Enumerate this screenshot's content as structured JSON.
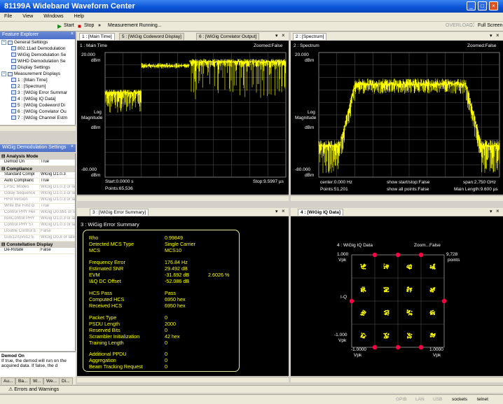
{
  "window": {
    "title": "81199A Wideband Waveform Center"
  },
  "menu": [
    "File",
    "View",
    "Windows",
    "Help"
  ],
  "toolbar": {
    "start": "Start",
    "stop": "Stop",
    "status": "Measurement Running...",
    "overload": "OVERLOAD",
    "fullscreen": "Full Screen"
  },
  "explorer": {
    "title": "Feature Explorer",
    "general": "General Settings",
    "general_items": [
      "802.11ad Demodulation",
      "WiGig Demodulation Se",
      "WiHD Demodulation Se",
      "Display Settings"
    ],
    "measurement": "Measurement Displays",
    "measurement_items": [
      "1 : [Main Time]",
      "2 : [Spectrum]",
      "3 : [WiGig Error Summar",
      "4 : [WiGig IQ Data]",
      "5 : [WiGig Codeword Di",
      "6 : [WiGig Correlator Ou",
      "7 : [WiGig Channel Estm"
    ]
  },
  "settings": {
    "title": "WiGig Demodulation Settings",
    "categories": [
      "Analysis Mode",
      "Compliance",
      "Constellation Display"
    ],
    "analysis": [
      {
        "k": "Demod On",
        "v": "True"
      }
    ],
    "compliance": [
      {
        "k": "Standard Compl",
        "v": "WiGig D1.0.3"
      },
      {
        "k": "Auto Complianc",
        "v": "True"
      },
      {
        "k": "LPSC Modes",
        "v": "WiGig D1.0.3 or late"
      },
      {
        "k": "Golay Sequence",
        "v": "WiGig D1.0.3 or late"
      },
      {
        "k": "HFill Version",
        "v": "WiGig D1.0.3 or late"
      },
      {
        "k": "Write the First G",
        "v": "True"
      },
      {
        "k": "Control PHY Her",
        "v": "WiGig D0.951 or la"
      },
      {
        "k": "nonControl PHY",
        "v": "WiGig D1.0.3 or late"
      },
      {
        "k": "Control PHY ST",
        "v": "WiGig D1.0.3 or late"
      },
      {
        "k": "Double Control E",
        "v": "False"
      },
      {
        "k": "Gu512/Gv512 E",
        "v": "WiGig D0.8 or later"
      }
    ],
    "constellation": [
      {
        "k": "De-Rotate",
        "v": "False"
      }
    ],
    "desc_title": "Demod On",
    "desc_text": "If true, the demod will run on the acquired data. If false, the d"
  },
  "bottom_tabs": [
    "Au...",
    "Ba...",
    "W...",
    "We...",
    "Di..."
  ],
  "main_time": {
    "tabs": [
      "1 : [Main Time]",
      "5 : [WiGig Codeword Display]",
      "6 : [WiGig Correlator Output]"
    ],
    "label": "1 : Main Time",
    "zoom": "Zoomed:False",
    "top": "20.000",
    "top_unit": "dBm",
    "ylabel1": "Log",
    "ylabel2": "Magnitude",
    "unit_mid": "dBm",
    "bottom": "-80.000",
    "bottom_unit": "dBm",
    "start": "Start:0.0000 s",
    "stop": "Stop:9.5997 µs",
    "points": "Points:65,536"
  },
  "spectrum": {
    "tab": "2 : [Spectrum]",
    "label": "2 : Spectrum",
    "zoom": "Zoomed:False",
    "top": "20.000",
    "top_unit": "dBm",
    "ylabel1": "Log",
    "ylabel2": "Magnitude",
    "unit_mid": "dBm",
    "bottom": "-80.000",
    "bottom_unit": "dBm",
    "center": "center:0.000 Hz",
    "show1": "show start/stop:False",
    "span": "span:2.750 GHz",
    "points": "Points:51,201",
    "show2": "show all points:False",
    "mainlen": "Main Length:9.600 µs"
  },
  "error_summary": {
    "tab": "3 : [WiGig Error Summary]",
    "label": "3 : WiGig Error Summary",
    "rows": [
      {
        "k": "Rho",
        "v": "0.99849"
      },
      {
        "k": "Detected MCS Type",
        "v": "Single Carrier"
      },
      {
        "k": "MCS",
        "v": "MCS10"
      },
      {
        "k": "Frequency Error",
        "v": "176.84 Hz"
      },
      {
        "k": "Estimated SNR",
        "v": "29.492 dB"
      },
      {
        "k": "EVM",
        "v": "-31.692 dB",
        "v2": "2.6026 %"
      },
      {
        "k": "I&Q DC Offset",
        "v": "-52.086 dB"
      },
      {
        "k": "HCS Pass",
        "v": "Pass"
      },
      {
        "k": "Computed HCS",
        "v": "6950 hex"
      },
      {
        "k": "Received HCS",
        "v": "6950 hex"
      },
      {
        "k": "Packet Type",
        "v": "0"
      },
      {
        "k": "PSDU Length",
        "v": "2000"
      },
      {
        "k": "Reserved Bits",
        "v": "0"
      },
      {
        "k": "Scrambler Initialization",
        "v": "42 hex"
      },
      {
        "k": "Training Length",
        "v": "0"
      },
      {
        "k": "Additional PPDU",
        "v": "0"
      },
      {
        "k": "Aggregation",
        "v": "0"
      },
      {
        "k": "Beam Tracking Request",
        "v": "0"
      }
    ]
  },
  "iq": {
    "tab": "4 : [WiGig IQ Data]",
    "label": "4 : WiGig IQ Data",
    "zoom": "Zoom...False",
    "top": "1.000",
    "top_unit": "Vpk",
    "ylabel": "I-Q",
    "bottom": "-1.000",
    "bottom_unit": "Vpk",
    "xleft": "-1.0000",
    "xleft_unit": "Vpk",
    "xright": "1.0000",
    "xright_unit": "Vpk",
    "points": "9,728",
    "points_unit": "points"
  },
  "errors": "Errors and Warnings",
  "status": {
    "gpib": "GPIB",
    "lan": "LAN",
    "usb": "USB",
    "sockets": "sockets",
    "telnet": "telnet"
  },
  "colors": {
    "trace": "#ffff00",
    "pilot": "#ff0044",
    "grid": "#808080",
    "title": "#0a53d6"
  }
}
